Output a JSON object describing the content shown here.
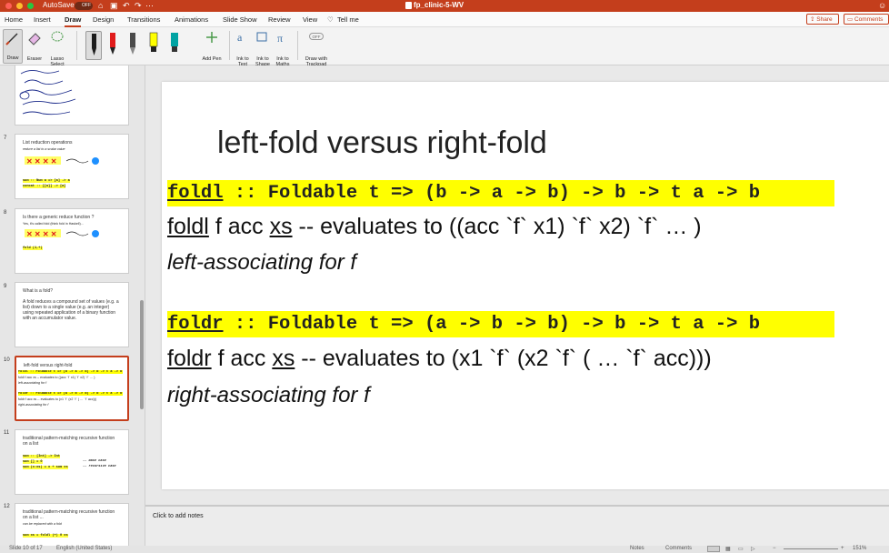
{
  "titlebar": {
    "autosave_label": "AutoSave",
    "autosave_state": "OFF",
    "document_title": "fp_clinic-5-WV",
    "dot_colors": [
      "#ff5f57",
      "#febc2e",
      "#28c840"
    ]
  },
  "menu": {
    "tabs": [
      {
        "label": "Home"
      },
      {
        "label": "Insert"
      },
      {
        "label": "Draw"
      },
      {
        "label": "Design"
      },
      {
        "label": "Transitions"
      },
      {
        "label": "Animations"
      },
      {
        "label": "Slide Show"
      },
      {
        "label": "Review"
      },
      {
        "label": "View"
      }
    ],
    "tell_me": "Tell me",
    "share": "Share",
    "comments": "Comments"
  },
  "ribbon": {
    "draw": "Draw",
    "eraser": "Eraser",
    "lasso": "Lasso Select",
    "add_pen": "Add Pen",
    "ink_to_text": "Ink to Text",
    "ink_to_shape": "Ink to Shape",
    "ink_to_maths": "Ink to Maths",
    "toggle": "OFF",
    "draw_trackpad": "Draw with Trackpad",
    "pen_colors": [
      "#1c1c1c",
      "#e01b1b",
      "#4a4a4a",
      "#ffff00",
      "#00a3a3"
    ]
  },
  "thumbnails": [
    {
      "num": "7",
      "title": "List reduction operations",
      "subtitle": "reduce a list to a scalar value",
      "code1": "sum :: Num a => [a] -> a",
      "code2": "concat :: [[a]] -> [a]"
    },
    {
      "num": "8",
      "title": "Is there a generic reduce function ?",
      "subtitle": "Yes, it's called fold (think fold in Haskell)...",
      "code1": "fold (1,+)"
    },
    {
      "num": "9",
      "title": "What is a fold?",
      "body": "A fold reduces a compound set of values (e.g. a list) down to a single value (e.g. an integer) using repeated application of a binary function with an accumulator value."
    },
    {
      "num": "10",
      "title": "left-fold versus right-fold"
    },
    {
      "num": "11",
      "title": "traditional pattern-matching recursive function on a list",
      "code1": "sum :: [Int] -> Int",
      "code2": "sum [] = 0",
      "code3": "sum (x:xs) = x + sum xs",
      "note1": "-- base case",
      "note2": "-- recursive case"
    },
    {
      "num": "12",
      "title": "traditional pattern-matching recursive function on a list ...",
      "subtitle": "can be replaced with a fold",
      "code1": "sum xs = foldl (+) 0 xs"
    }
  ],
  "slide": {
    "title": "left-fold versus right-fold",
    "foldl_name": "foldl",
    "foldl_sig_rest": " :: Foldable t => (b -> a -> b) -> b -> t a -> b",
    "foldl_fn": "foldl",
    "foldl_mid": " f acc ",
    "foldl_xs": "xs",
    "foldl_eval": " --  evaluates to  ((acc `f` x1) `f` x2) `f` … )",
    "foldl_desc": "left-associating for f",
    "foldr_name": "foldr",
    "foldr_sig_rest": " :: Foldable t => (a -> b -> b) -> b -> t a -> b",
    "foldr_fn": "foldr",
    "foldr_mid": " f acc ",
    "foldr_xs": "xs",
    "foldr_eval": " --  evaluates to  (x1 `f` (x2 `f` (  …  `f` acc)))",
    "foldr_desc": "right-associating for f"
  },
  "notes": {
    "placeholder": "Click to add notes"
  },
  "status": {
    "slide_of": "Slide 10 of 17",
    "language": "English (United States)",
    "notes": "Notes",
    "comments": "Comments",
    "zoom": "151%"
  }
}
